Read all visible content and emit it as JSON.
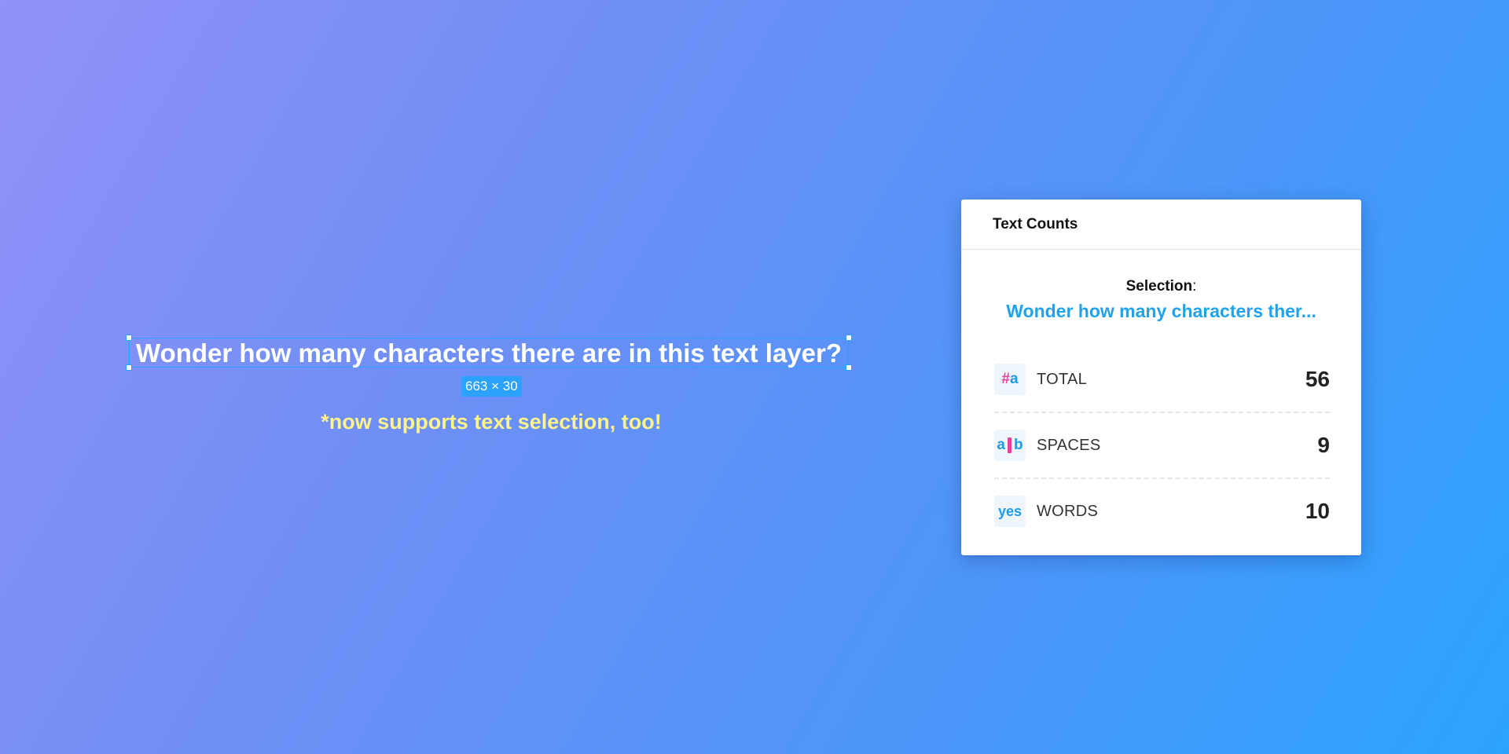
{
  "canvas": {
    "layer_text": "Wonder how many characters there are in this text layer?",
    "dimensions_badge": "663 × 30",
    "subtitle": "*now supports text selection, too!",
    "colors": {
      "selection_border": "#2ba3fe",
      "subtitle": "#fff38c"
    }
  },
  "panel": {
    "title": "Text Counts",
    "selection_label": "Selection",
    "selection_colon": ":",
    "selection_preview": "Wonder how many characters ther...",
    "stats": [
      {
        "icon": "hash-a-icon",
        "icon_text_1": "#",
        "icon_text_2": "a",
        "label": "TOTAL",
        "value": "56"
      },
      {
        "icon": "space-between-icon",
        "icon_text_1": "a",
        "icon_text_2": "b",
        "label": "SPACES",
        "value": "9"
      },
      {
        "icon": "yes-words-icon",
        "icon_text_1": "yes",
        "label": "WORDS",
        "value": "10"
      }
    ],
    "colors": {
      "accent": "#1ea3ee",
      "pink": "#e0449a"
    }
  }
}
